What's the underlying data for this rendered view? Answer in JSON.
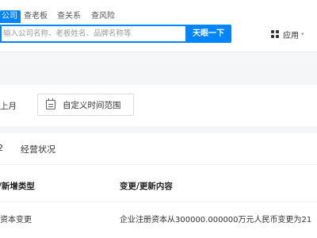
{
  "header": {
    "tabs": [
      {
        "label": "公司",
        "active": true
      },
      {
        "label": "查老板",
        "active": false
      },
      {
        "label": "查关系",
        "active": false
      },
      {
        "label": "查风险",
        "active": false
      }
    ],
    "search": {
      "placeholder": "输入公司名称、老板姓名、品牌名称等",
      "button_label": "天眼一下"
    },
    "apps": {
      "label": "应用",
      "icon": "apps-grid-icon",
      "caret": "▾"
    }
  },
  "filters": {
    "month_label": "上月",
    "date_range_label": "自定义时间范围",
    "date_range_icon": "calendar-icon"
  },
  "section_tabs": [
    {
      "label": "2"
    },
    {
      "label": "经营状况"
    }
  ],
  "table": {
    "columns": [
      "/新增类型",
      "变更/更新内容"
    ],
    "rows": [
      [
        "资本变更",
        "企业注册资本从300000.000000万元人民币变更为21"
      ]
    ]
  },
  "colors": {
    "accent": "#0084ff",
    "page_bg": "#f5f6f8"
  }
}
